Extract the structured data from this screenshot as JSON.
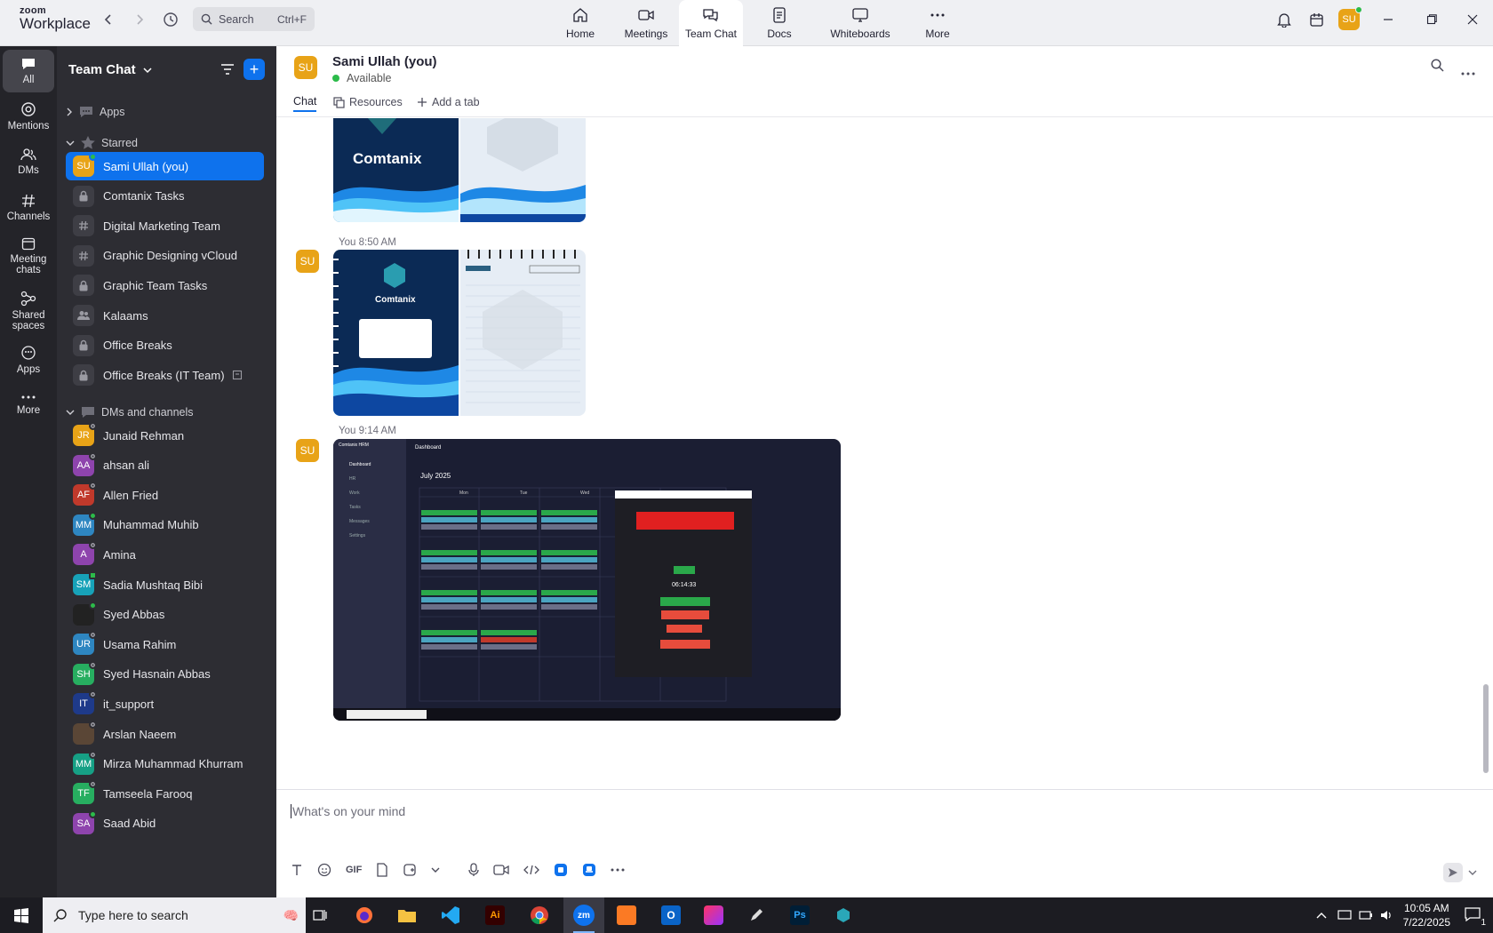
{
  "app": {
    "logo_line1": "zoom",
    "logo_line2": "Workplace"
  },
  "topbar": {
    "search_label": "Search",
    "search_shortcut": "Ctrl+F",
    "tabs": [
      {
        "label": "Home",
        "icon": "home-icon"
      },
      {
        "label": "Meetings",
        "icon": "video-icon"
      },
      {
        "label": "Team Chat",
        "icon": "chat-icon"
      },
      {
        "label": "Docs",
        "icon": "docs-icon"
      },
      {
        "label": "Whiteboards",
        "icon": "whiteboard-icon"
      },
      {
        "label": "More",
        "icon": "more-icon"
      }
    ],
    "active_tab": "Team Chat",
    "user_initials": "SU"
  },
  "rail": {
    "items": [
      {
        "label": "All",
        "icon": "chat-bubble-icon"
      },
      {
        "label": "Mentions",
        "icon": "at-icon"
      },
      {
        "label": "DMs",
        "icon": "people-icon"
      },
      {
        "label": "Channels",
        "icon": "hash-icon"
      },
      {
        "label": "Meeting chats",
        "icon": "calendar-icon"
      },
      {
        "label": "Shared spaces",
        "icon": "share-icon"
      },
      {
        "label": "Apps",
        "icon": "apps-icon"
      },
      {
        "label": "More",
        "icon": "more-icon"
      }
    ],
    "active": "All"
  },
  "sidebar": {
    "title": "Team Chat",
    "sections": {
      "apps": "Apps",
      "starred": "Starred",
      "dms": "DMs and channels"
    },
    "starred": [
      {
        "label": "Sami Ullah (you)",
        "initials": "SU",
        "color": "#e8a317",
        "status": "online",
        "active": true
      },
      {
        "label": "Comtanix Tasks",
        "type": "lock"
      },
      {
        "label": "Digital Marketing Team",
        "type": "hash"
      },
      {
        "label": "Graphic Designing vCloud",
        "type": "hash"
      },
      {
        "label": "Graphic Team Tasks",
        "type": "lock"
      },
      {
        "label": "Kalaams",
        "type": "group"
      },
      {
        "label": "Office Breaks",
        "type": "lock"
      },
      {
        "label": "Office Breaks (IT Team)",
        "type": "lock",
        "extra": true
      }
    ],
    "dms": [
      {
        "label": "Junaid Rehman",
        "initials": "JR",
        "color": "#e8a317",
        "status": "offline"
      },
      {
        "label": "ahsan ali",
        "initials": "AA",
        "color": "#8e44ad",
        "status": "offline"
      },
      {
        "label": "Allen Fried",
        "initials": "AF",
        "color": "#c0392b",
        "status": "offline"
      },
      {
        "label": "Muhammad Muhib",
        "initials": "MM",
        "color": "#2e86c1",
        "status": "online"
      },
      {
        "label": "Amina",
        "initials": "A",
        "color": "#8e44ad",
        "status": "offline"
      },
      {
        "label": "Sadia Mushtaq Bibi",
        "initials": "SM",
        "color": "#17a2b8",
        "status": "phone"
      },
      {
        "label": "Syed Abbas",
        "initials": "",
        "color": "#222",
        "status": "online"
      },
      {
        "label": "Usama Rahim",
        "initials": "UR",
        "color": "#2e86c1",
        "status": "offline"
      },
      {
        "label": "Syed Hasnain Abbas",
        "initials": "SH",
        "color": "#27ae60",
        "status": "offline"
      },
      {
        "label": "it_support",
        "initials": "IT",
        "color": "#1e3a8a",
        "status": "offline"
      },
      {
        "label": "Arslan Naeem",
        "initials": "",
        "color": "#5a4636",
        "status": "offline"
      },
      {
        "label": "Mirza Muhammad Khurram",
        "initials": "MM",
        "color": "#16a085",
        "status": "offline"
      },
      {
        "label": "Tamseela Farooq",
        "initials": "TF",
        "color": "#27ae60",
        "status": "offline"
      },
      {
        "label": "Saad Abid",
        "initials": "SA",
        "color": "#8e44ad",
        "status": "online"
      }
    ]
  },
  "chat": {
    "name": "Sami Ullah (you)",
    "status": "Available",
    "avatar": "SU",
    "tabs": [
      {
        "label": "Chat"
      },
      {
        "label": "Resources"
      },
      {
        "label": "Add a tab"
      }
    ],
    "messages": [
      {
        "sender": "You",
        "time": "8:50 AM",
        "brand": "Comtanix"
      },
      {
        "sender": "You",
        "time": "9:14 AM"
      }
    ],
    "first_image_brand": "Comtanix",
    "screenshot": {
      "app": "Comtanix HRM",
      "page": "Dashboard",
      "month": "July 2025",
      "days": [
        "Mon",
        "Tue",
        "Wed"
      ],
      "nav": [
        "Dashboard",
        "HR",
        "Work",
        "Tasks",
        "Messages",
        "Settings"
      ],
      "dialog_timer": "06:14:33"
    },
    "composer_placeholder": "What's on your mind",
    "gif_label": "GIF"
  },
  "taskbar": {
    "search_placeholder": "Type here to search",
    "time": "10:05 AM",
    "date": "7/22/2025",
    "notif_count": "1"
  }
}
